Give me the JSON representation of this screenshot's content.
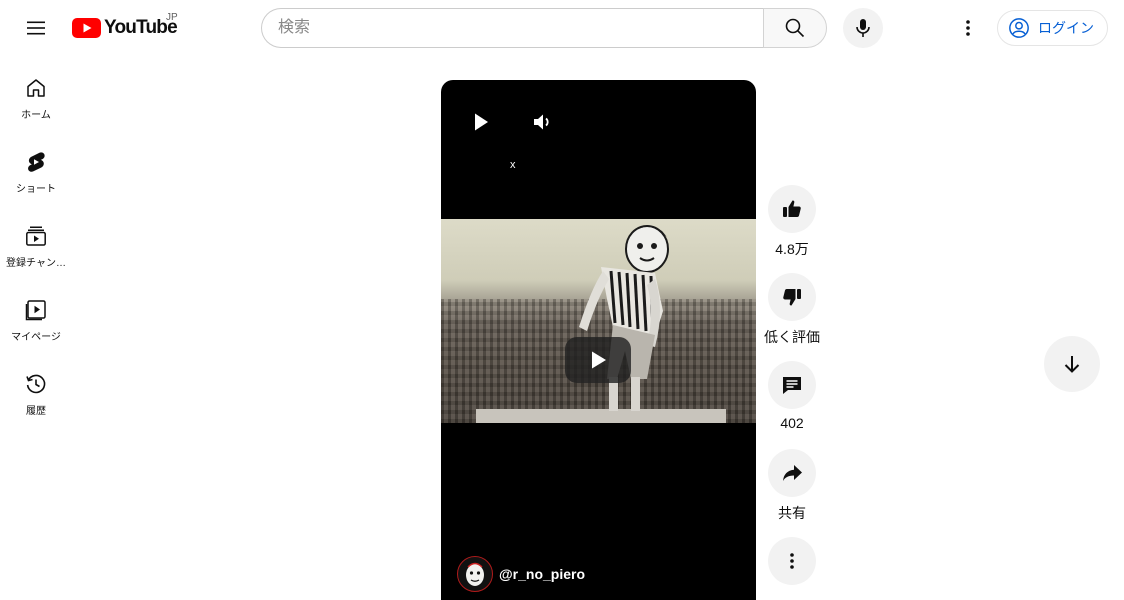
{
  "header": {
    "logo_text": "YouTube",
    "country_code": "JP",
    "search": {
      "placeholder": "検索",
      "value": ""
    },
    "login_label": "ログイン"
  },
  "sidebar": {
    "items": [
      {
        "label": "ホーム",
        "icon": "home-icon"
      },
      {
        "label": "ショート",
        "icon": "shorts-icon"
      },
      {
        "label": "登録チャン…",
        "icon": "subscriptions-icon"
      },
      {
        "label": "マイページ",
        "icon": "library-icon"
      },
      {
        "label": "履歴",
        "icon": "history-icon"
      }
    ]
  },
  "player": {
    "overlay_text": "x",
    "channel_handle": "@r_no_piero"
  },
  "actions": {
    "like_count": "4.8万",
    "dislike_label": "低く評価",
    "comment_count": "402",
    "share_label": "共有"
  },
  "colors": {
    "brand_red": "#ff0000",
    "link_blue": "#065fd4",
    "button_gray": "#f2f2f2"
  }
}
